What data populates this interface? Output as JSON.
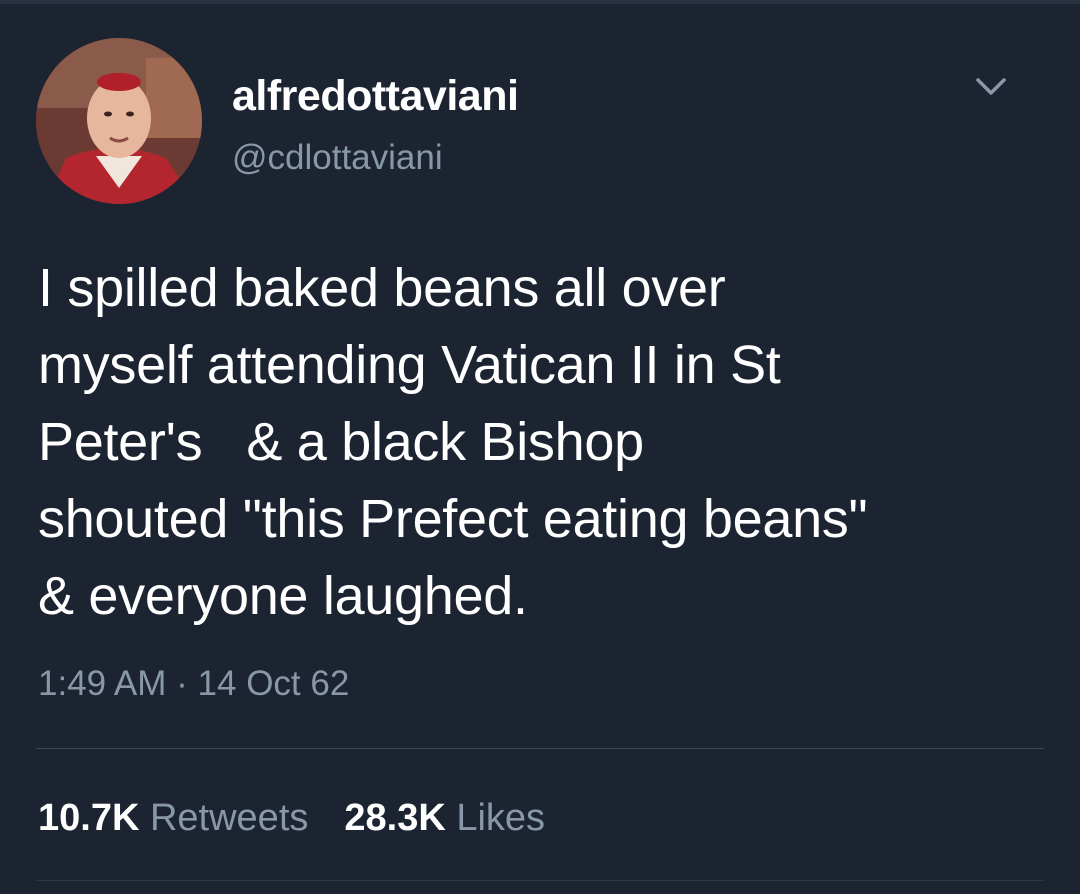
{
  "user": {
    "display_name": "alfredottaviani",
    "handle": "@cdlottaviani"
  },
  "tweet": {
    "text": "I spilled baked beans all over\nmyself attending Vatican II in St\nPeter's   & a black Bishop\nshouted \"this Prefect eating beans\"\n& everyone laughed.",
    "time": "1:49 AM",
    "separator": "·",
    "date": "14 Oct 62"
  },
  "stats": {
    "retweets_count": "10.7K",
    "retweets_label": "Retweets",
    "likes_count": "28.3K",
    "likes_label": "Likes"
  },
  "icons": {
    "menu": "chevron-down-icon"
  },
  "colors": {
    "background": "#1b2430",
    "secondary_text": "#8898a8",
    "divider": "#3a4654"
  }
}
